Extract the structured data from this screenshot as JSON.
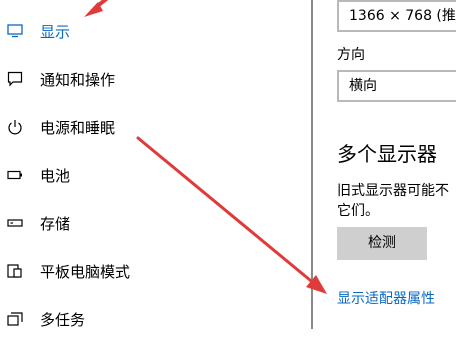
{
  "sidebar": {
    "items": [
      {
        "label": "显示",
        "icon": "monitor-icon",
        "active": true
      },
      {
        "label": "通知和操作",
        "icon": "chat-icon",
        "active": false
      },
      {
        "label": "电源和睡眠",
        "icon": "power-icon",
        "active": false
      },
      {
        "label": "电池",
        "icon": "battery-icon",
        "active": false
      },
      {
        "label": "存储",
        "icon": "storage-icon",
        "active": false
      },
      {
        "label": "平板电脑模式",
        "icon": "tablet-mode-icon",
        "active": false
      },
      {
        "label": "多任务",
        "icon": "multitask-icon",
        "active": false
      }
    ]
  },
  "content": {
    "resolution_value": "1366 × 768 (推荐",
    "orientation_label": "方向",
    "orientation_value": "横向",
    "multi_display_heading": "多个显示器",
    "multi_display_text_line1": "旧式显示器可能不",
    "multi_display_text_line2": "它们。",
    "detect_button": "检测",
    "adapter_link": "显示适配器属性"
  },
  "colors": {
    "accent": "#0a69c4",
    "arrow": "#e03a3a",
    "button_bg": "#cfcfcf"
  }
}
